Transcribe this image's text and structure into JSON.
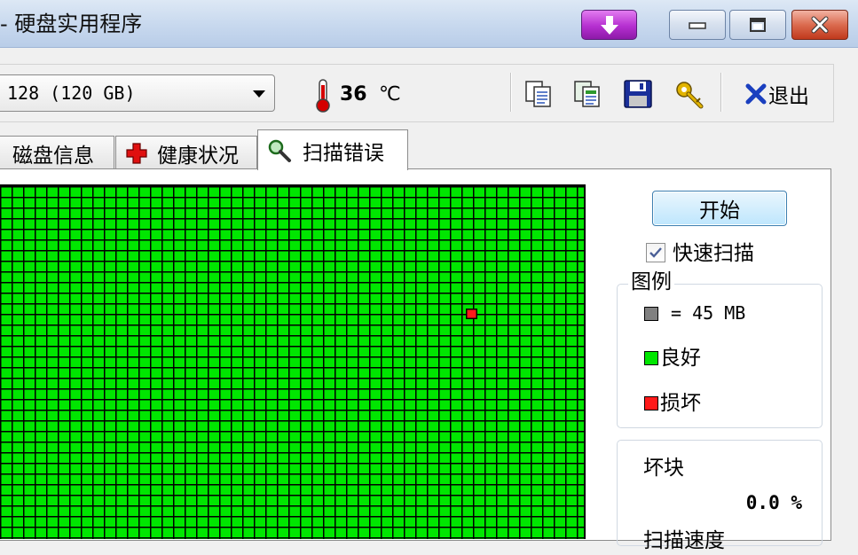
{
  "window": {
    "title": "- 硬盘实用程序"
  },
  "toolbar": {
    "drive": "128 (120 GB)",
    "temperature": "36",
    "temperature_unit": "℃",
    "exit_label": "退出"
  },
  "tabs": [
    {
      "label": "磁盘信息",
      "active": false
    },
    {
      "label": "健康状况",
      "active": false
    },
    {
      "label": "扫描错误",
      "active": true
    }
  ],
  "scan": {
    "start_label": "开始",
    "quick_scan_label": "快速扫描",
    "quick_scan_checked": true,
    "legend_title": "图例",
    "legend_block_size": "= 45 MB",
    "legend_good": "良好",
    "legend_bad": "损坏",
    "bad_blocks_label": "坏块",
    "bad_blocks_value": "0.0 %",
    "next_label": "扫描速度"
  },
  "colors": {
    "good": "#00e600",
    "bad": "#ff1a1a",
    "block": "#808080",
    "accent": "#b52fd0"
  }
}
